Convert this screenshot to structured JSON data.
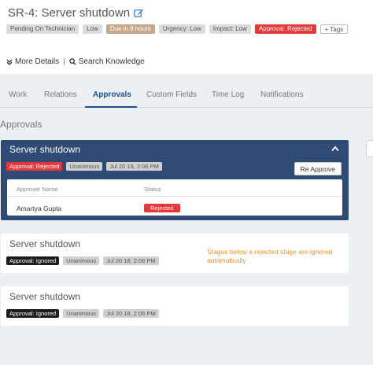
{
  "header": {
    "title": "SR-4: Server shutdown",
    "tags": [
      {
        "label": "Pending On Technician",
        "style": "gray"
      },
      {
        "label": "Low",
        "style": "gray"
      },
      {
        "label": "Due in 8 hours",
        "style": "due"
      },
      {
        "label": "Urgency: Low",
        "style": "gray"
      },
      {
        "label": "Impact: Low",
        "style": "gray"
      },
      {
        "label": "Approval: Rejected",
        "style": "rejected"
      }
    ],
    "add_tags_label": "+ Tags"
  },
  "links": {
    "more_details": "More Details",
    "separator": "|",
    "search_knowledge": "Search Knowledge"
  },
  "tabs": [
    "Work",
    "Relations",
    "Approvals",
    "Custom Fields",
    "Time Log",
    "Notifications"
  ],
  "section_title": "Approvals",
  "stages": [
    {
      "title": "Server shutdown",
      "status": "Approval: Rejected",
      "type": "Unanimous",
      "date": "Jul 20 18, 2:06 PM",
      "action_label": "Re Approve",
      "table": {
        "col_approver": "Approver Name",
        "col_status": "Status",
        "rows": [
          {
            "name": "Amartya Gupta",
            "status": "Rejected"
          }
        ]
      }
    },
    {
      "title": "Server shutdown",
      "status": "Approval: Ignored",
      "type": "Unanimous",
      "date": "Jul 20 18, 2:06 PM",
      "note": "Stages below a rejected stage are ignored automatically"
    },
    {
      "title": "Server shutdown",
      "status": "Approval: Ignored",
      "type": "Unanimous",
      "date": "Jul 20 18, 2:06 PM"
    }
  ],
  "colors": {
    "accent": "#1f4f8f",
    "active_card": "#2e4a75",
    "rejected": "#e5383b",
    "due": "#c8a68a",
    "note": "#f0932b"
  }
}
